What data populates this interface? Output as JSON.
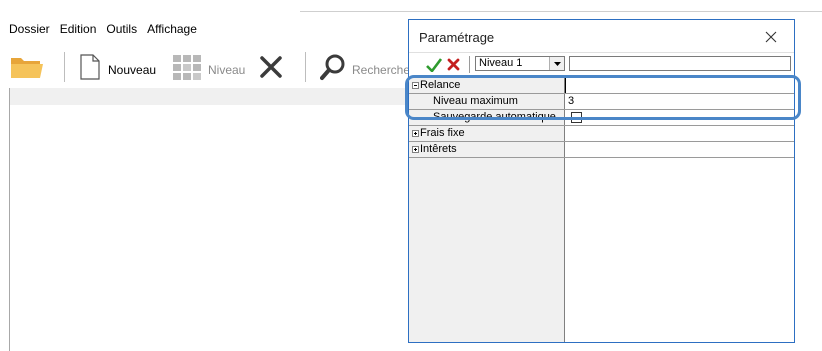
{
  "menu": [
    "Dossier",
    "Edition",
    "Outils",
    "Affichage"
  ],
  "toolbar": {
    "new_label": "Nouveau",
    "level_label": "Niveau",
    "search_label": "Recherche"
  },
  "dialog": {
    "title": "Paramétrage",
    "level_select": "Niveau 1"
  },
  "grid": {
    "rows": [
      {
        "label": "Relance",
        "value": "",
        "type": "category",
        "expanded": true
      },
      {
        "label": "Niveau maximum",
        "value": "3",
        "type": "property"
      },
      {
        "label": "Sauvegarde automatique",
        "value": "",
        "type": "checkbox",
        "checked": false
      },
      {
        "label": "Frais fixe",
        "value": "",
        "type": "category",
        "expanded": false
      },
      {
        "label": "Intêrets",
        "value": "",
        "type": "category",
        "expanded": false
      }
    ]
  },
  "colors": {
    "dialog_border": "#2d6fc2",
    "highlight": "#4a86c8",
    "ok_check": "#2e9b2e",
    "cancel_cross": "#c41e1e"
  },
  "icons": {
    "folder": "open-folder-icon",
    "new": "new-document-icon",
    "level": "grid-level-icon",
    "delete": "delete-x-icon",
    "search": "magnifier-icon",
    "ok": "check-icon",
    "cancel": "cross-icon",
    "close": "close-icon",
    "dropdown": "dropdown-arrow-icon"
  }
}
